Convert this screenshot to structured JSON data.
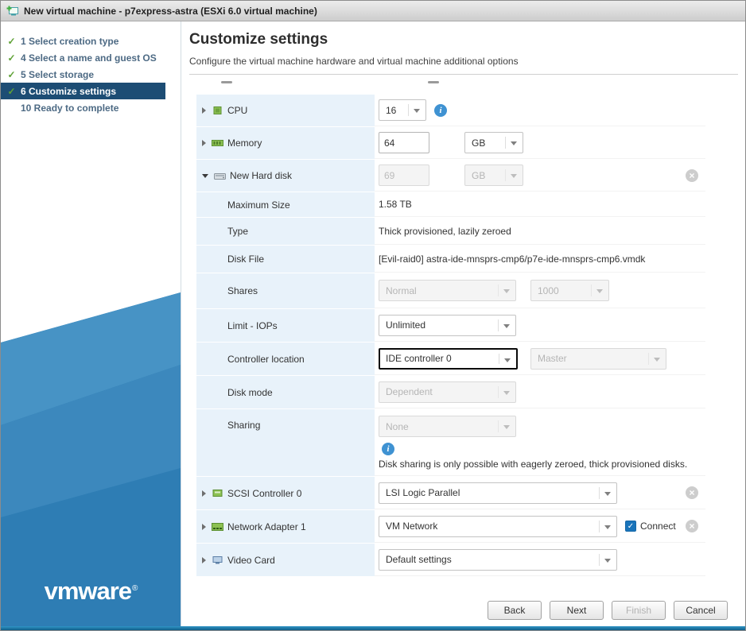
{
  "window": {
    "title": "New virtual machine - p7express-astra (ESXi 6.0 virtual machine)"
  },
  "colors": {
    "brand_blue": "#2e7db4",
    "active_step_bg": "#1d4d74",
    "check_green": "#5fa236",
    "info_blue": "#3f92d2",
    "row_bg": "#e8f2fa"
  },
  "sidebar": {
    "steps": [
      {
        "label": "1 Select creation type",
        "checked": true,
        "active": false
      },
      {
        "label": "4 Select a name and guest OS",
        "checked": true,
        "active": false
      },
      {
        "label": "5 Select storage",
        "checked": true,
        "active": false
      },
      {
        "label": "6 Customize settings",
        "checked": true,
        "active": true
      },
      {
        "label": "10 Ready to complete",
        "checked": false,
        "active": false
      }
    ],
    "logo": "vmware",
    "logo_reg": "®"
  },
  "main": {
    "title": "Customize settings",
    "subtitle": "Configure the virtual machine hardware and virtual machine additional options"
  },
  "settings": {
    "cpu": {
      "label": "CPU",
      "value": "16"
    },
    "memory": {
      "label": "Memory",
      "value": "64",
      "unit": "GB"
    },
    "hard_disk": {
      "label": "New Hard disk",
      "value": "69",
      "unit": "GB"
    },
    "maximum_size": {
      "label": "Maximum Size",
      "value": "1.58 TB"
    },
    "type": {
      "label": "Type",
      "value": "Thick provisioned, lazily zeroed"
    },
    "disk_file": {
      "label": "Disk File",
      "value": "[Evil-raid0] astra-ide-mnsprs-cmp6/p7e-ide-mnsprs-cmp6.vmdk"
    },
    "shares": {
      "label": "Shares",
      "value": "Normal",
      "value2": "1000"
    },
    "limit_iops": {
      "label": "Limit - IOPs",
      "value": "Unlimited"
    },
    "controller_location": {
      "label": "Controller location",
      "value": "IDE controller 0",
      "value2": "Master"
    },
    "disk_mode": {
      "label": "Disk mode",
      "value": "Dependent"
    },
    "sharing": {
      "label": "Sharing",
      "value": "None",
      "note": "Disk sharing is only possible with eagerly zeroed, thick provisioned disks."
    },
    "scsi_controller": {
      "label": "SCSI Controller 0",
      "value": "LSI Logic Parallel"
    },
    "network_adapter": {
      "label": "Network Adapter 1",
      "value": "VM Network",
      "connect_label": "Connect",
      "connected": true
    },
    "video_card": {
      "label": "Video Card",
      "value": "Default settings"
    }
  },
  "footer": {
    "back": "Back",
    "next": "Next",
    "finish": "Finish",
    "cancel": "Cancel"
  }
}
